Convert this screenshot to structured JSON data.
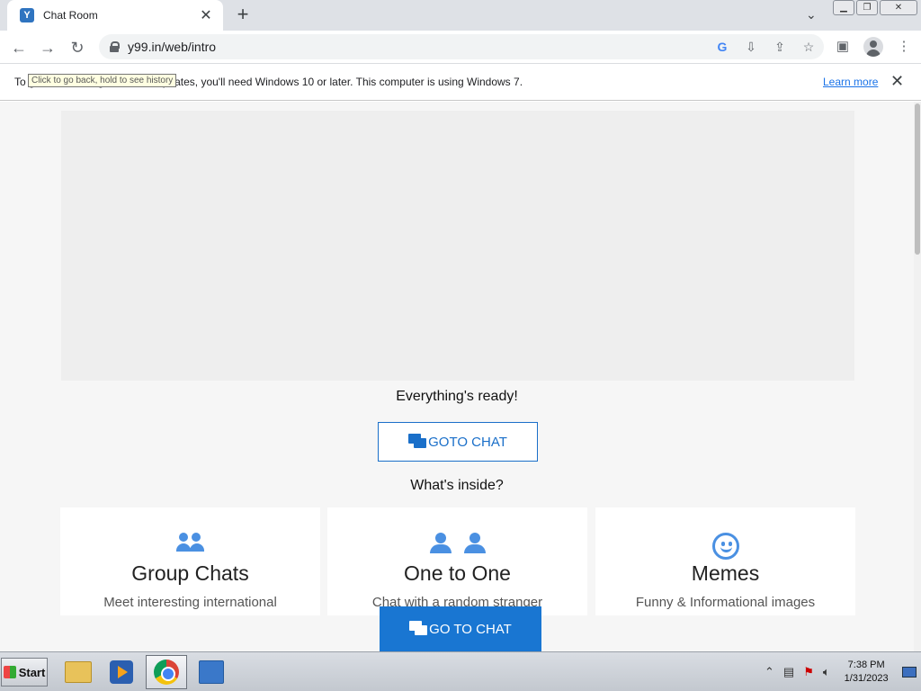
{
  "browser": {
    "tab": {
      "title": "Chat Room",
      "favicon": "Y"
    },
    "url": "y99.in/web/intro",
    "infobar": {
      "text": "To get future Google Chrome updates, you'll need Windows 10 or later. This computer is using Windows 7.",
      "learn_more": "Learn more"
    },
    "tooltip": "Click to go back, hold to see history"
  },
  "page": {
    "ready_text": "Everything's ready!",
    "goto_chat_label": "GOTO CHAT",
    "whats_inside": "What's inside?",
    "cards": [
      {
        "icon": "group-icon",
        "title": "Group Chats",
        "desc": "Meet interesting international"
      },
      {
        "icon": "one-to-one-icon",
        "title": "One to One",
        "desc": "Chat with a random stranger"
      },
      {
        "icon": "smile-icon",
        "title": "Memes",
        "desc": "Funny & Informational images"
      }
    ],
    "floating_button_label": "GO TO CHAT",
    "accent_color": "#1976d2"
  },
  "taskbar": {
    "start_label": "Start",
    "time": "7:38 PM",
    "date": "1/31/2023"
  }
}
